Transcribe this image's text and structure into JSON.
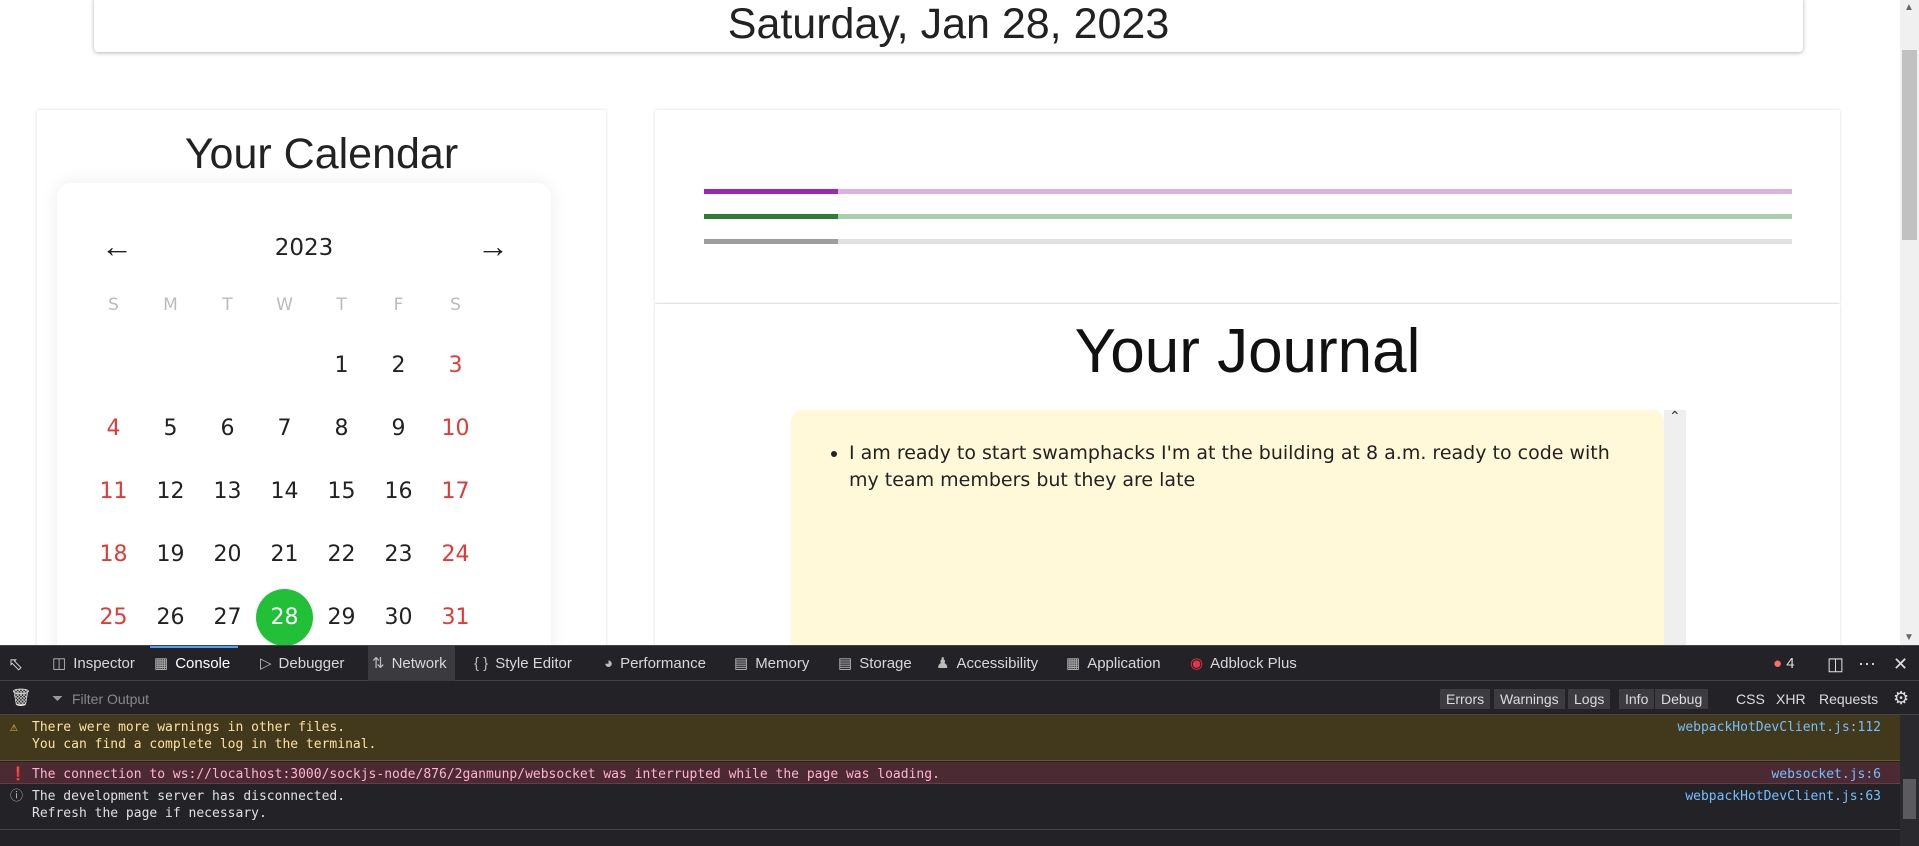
{
  "date_header": "Saturday, Jan 28, 2023",
  "calendar": {
    "title": "Your Calendar",
    "year": "2023",
    "prev_icon": "arrow-left-icon",
    "next_icon": "arrow-right-icon",
    "weekdays": [
      "S",
      "M",
      "T",
      "W",
      "T",
      "F",
      "S"
    ],
    "days": [
      "1",
      "2",
      "3",
      "4",
      "5",
      "6",
      "7",
      "8",
      "9",
      "10",
      "11",
      "12",
      "13",
      "14",
      "15",
      "16",
      "17",
      "18",
      "19",
      "20",
      "21",
      "22",
      "23",
      "24",
      "25",
      "26",
      "27",
      "28",
      "29",
      "30",
      "31"
    ],
    "first_weekday": 4,
    "selected": "28",
    "colors": {
      "weekend": "#e53935",
      "selected": "#22c039"
    }
  },
  "progress_bars": [
    {
      "fraction": 0.123,
      "fill_color": "#9c27b0",
      "track_color": "#dfb0e4"
    },
    {
      "fraction": 0.123,
      "fill_color": "#2e7d32",
      "track_color": "#a9cfa9"
    },
    {
      "fraction": 0.123,
      "fill_color": "#9e9e9e",
      "track_color": "#e0e0e0"
    }
  ],
  "journal": {
    "title": "Your Journal",
    "entries": [
      "I am ready to start swamphacks I'm at the building at 8 a.m. ready to code with my team members but they are late"
    ]
  },
  "devtools": {
    "tabs": [
      {
        "label": "Inspector",
        "icon": "inspector-icon"
      },
      {
        "label": "Console",
        "icon": "console-icon",
        "active": true
      },
      {
        "label": "Debugger",
        "icon": "debugger-icon"
      },
      {
        "label": "Network",
        "icon": "network-icon"
      },
      {
        "label": "Style Editor",
        "icon": "style-editor-icon"
      },
      {
        "label": "Performance",
        "icon": "performance-icon"
      },
      {
        "label": "Memory",
        "icon": "memory-icon"
      },
      {
        "label": "Storage",
        "icon": "storage-icon"
      },
      {
        "label": "Accessibility",
        "icon": "accessibility-icon"
      },
      {
        "label": "Application",
        "icon": "application-icon"
      },
      {
        "label": "Adblock Plus",
        "icon": "adblock-plus-icon"
      }
    ],
    "error_count": "4",
    "filter_placeholder": "Filter Output",
    "filters": [
      "Errors",
      "Warnings",
      "Logs",
      "Info",
      "Debug"
    ],
    "extra_filters": [
      "CSS",
      "XHR",
      "Requests"
    ],
    "messages": [
      {
        "level": "warning",
        "lines": "There were more warnings in other files.\nYou can find a complete log in the terminal.",
        "source": "webpackHotDevClient.js:112"
      },
      {
        "level": "error",
        "lines": "The connection to ws://localhost:3000/sockjs-node/876/2ganmunp/websocket was interrupted while the page was loading.",
        "source": "websocket.js:6"
      },
      {
        "level": "info",
        "lines": "The development server has disconnected.\nRefresh the page if necessary.",
        "source": "webpackHotDevClient.js:63"
      }
    ]
  }
}
